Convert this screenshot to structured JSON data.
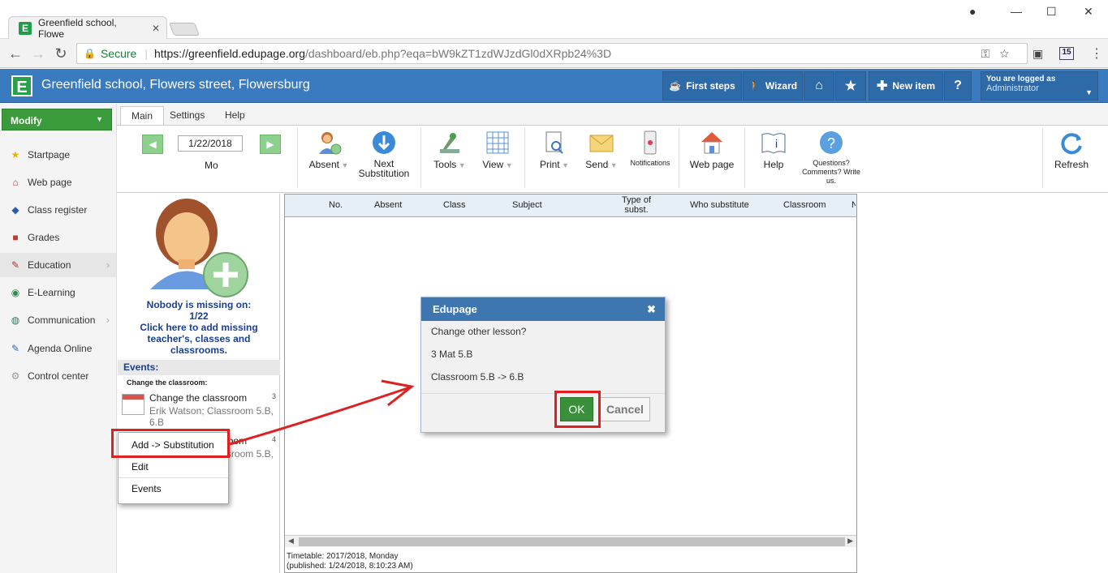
{
  "browser": {
    "tab_title": "Greenfield school, Flowe",
    "secure_label": "Secure",
    "url_scheme": "https://",
    "url_host": "greenfield.edupage.org",
    "url_path": "/dashboard/eb.php?eqa=bW9kZT1zdWJzdGl0dXRpb24%3D",
    "badge": "15"
  },
  "header": {
    "school_name": "Greenfield school, Flowers street, Flowersburg",
    "first_steps": "First steps",
    "wizard": "Wizard",
    "new_item": "New item",
    "help": "?",
    "logged_in_label": "You are logged as",
    "logged_in_user": "Administrator"
  },
  "sidebar": {
    "modify": "Modify",
    "items": [
      {
        "label": "Startpage",
        "icon": "star-icon"
      },
      {
        "label": "Web page",
        "icon": "webpage-icon"
      },
      {
        "label": "Class register",
        "icon": "book-icon"
      },
      {
        "label": "Grades",
        "icon": "grades-icon"
      },
      {
        "label": "Education",
        "icon": "education-icon"
      },
      {
        "label": "E-Learning",
        "icon": "elearning-icon"
      },
      {
        "label": "Communication",
        "icon": "communication-icon"
      },
      {
        "label": "Agenda Online",
        "icon": "pen-icon"
      },
      {
        "label": "Control center",
        "icon": "control-icon"
      }
    ]
  },
  "ribbon": {
    "tabs": [
      "Main",
      "Settings",
      "Help"
    ],
    "date": "1/22/2018",
    "day": "Mo",
    "buttons": {
      "absent": "Absent",
      "next_sub_1": "Next",
      "next_sub_2": "Substitution",
      "tools": "Tools",
      "view": "View",
      "print": "Print",
      "send": "Send",
      "notifications": "Notifications",
      "web_page": "Web page",
      "help": "Help",
      "questions_1": "Questions?",
      "questions_2": "Comments? Write",
      "questions_3": "us.",
      "refresh": "Refresh"
    }
  },
  "left_panel": {
    "missing_1": "Nobody is missing on:",
    "missing_2": "1/22",
    "missing_3": "Click here to add missing",
    "missing_4": "teacher's, classes and",
    "missing_5": "classrooms.",
    "events_header": "Events:",
    "events_sub": "Change the classroom:",
    "events": [
      {
        "title": "Change the classroom",
        "desc": "Erik Watson; Classroom 5.B, 6.B",
        "num": "3"
      },
      {
        "title": "Change the classroom",
        "desc": "Erik Watson; Classroom 5.B,",
        "num": "4"
      }
    ]
  },
  "table": {
    "columns": [
      "No.",
      "Absent",
      "Class",
      "Subject",
      "Type of subst.",
      "Who substitute",
      "Classroom",
      "N"
    ],
    "timetable_1": "Timetable: 2017/2018, Monday",
    "timetable_2": "(published: 1/24/2018, 8:10:23 AM)"
  },
  "context_menu": {
    "items": [
      "Add -> Substitution",
      "Edit",
      "Events"
    ]
  },
  "dialog": {
    "title": "Edupage",
    "line1": "Change other lesson?",
    "line2": "3 Mat 5.B",
    "line3": "Classroom 5.B -> 6.B",
    "ok": "OK",
    "cancel": "Cancel"
  },
  "colors": {
    "header_blue": "#3a7bbf",
    "modify_green": "#3a9b3a",
    "highlight_red": "#e02020"
  }
}
